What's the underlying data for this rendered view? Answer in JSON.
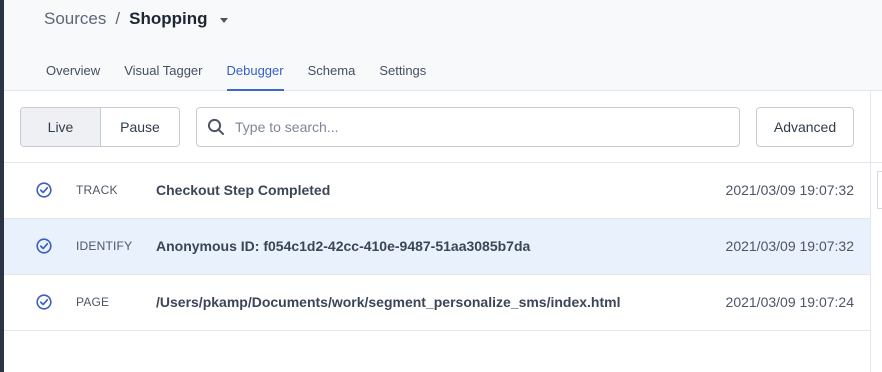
{
  "breadcrumb": {
    "parent": "Sources",
    "separator": "/",
    "current": "Shopping"
  },
  "tabs": [
    {
      "label": "Overview",
      "active": false
    },
    {
      "label": "Visual Tagger",
      "active": false
    },
    {
      "label": "Debugger",
      "active": true
    },
    {
      "label": "Schema",
      "active": false
    },
    {
      "label": "Settings",
      "active": false
    }
  ],
  "toolbar": {
    "live_label": "Live",
    "pause_label": "Pause",
    "mode_selected": "Live",
    "search_placeholder": "Type to search...",
    "search_value": "",
    "advanced_label": "Advanced"
  },
  "events": [
    {
      "type": "TRACK",
      "description": "Checkout Step Completed",
      "timestamp": "2021/03/09 19:07:32",
      "selected": false,
      "icon": "check-circle-icon"
    },
    {
      "type": "IDENTIFY",
      "description": "Anonymous ID: f054c1d2-42cc-410e-9487-51aa3085b7da",
      "timestamp": "2021/03/09 19:07:32",
      "selected": true,
      "icon": "check-circle-icon"
    },
    {
      "type": "PAGE",
      "description": "/Users/pkamp/Documents/work/segment_personalize_sms/index.html",
      "timestamp": "2021/03/09 19:07:24",
      "selected": false,
      "icon": "check-circle-icon"
    }
  ],
  "colors": {
    "accent": "#3a67d3",
    "selected_row": "#e8f1fc",
    "check_icon": "#3a5fc0",
    "left_rail": "#2b3445"
  }
}
